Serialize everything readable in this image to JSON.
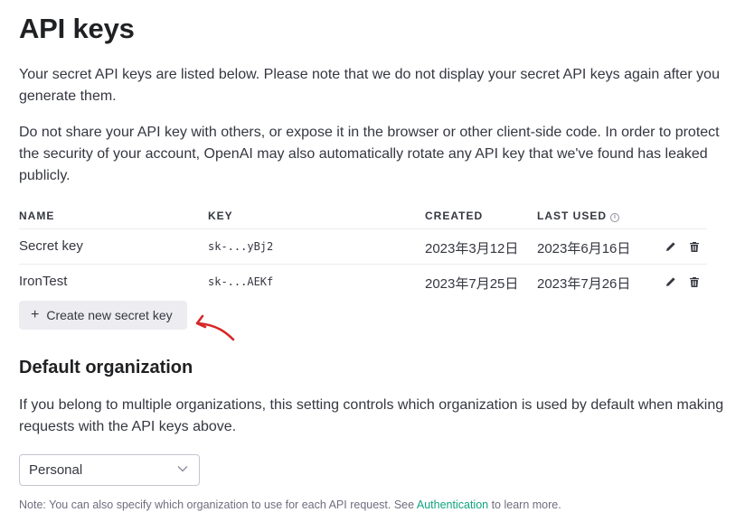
{
  "page": {
    "title": "API keys",
    "intro": "Your secret API keys are listed below. Please note that we do not display your secret API keys again after you generate them.",
    "warning": "Do not share your API key with others, or expose it in the browser or other client-side code. In order to protect the security of your account, OpenAI may also automatically rotate any API key that we've found has leaked publicly."
  },
  "table": {
    "headers": {
      "name": "NAME",
      "key": "KEY",
      "created": "CREATED",
      "last_used": "LAST USED",
      "info_glyph": "i"
    },
    "rows": [
      {
        "name": "Secret key",
        "key": "sk-...yBj2",
        "created": "2023年3月12日",
        "last_used": "2023年6月16日"
      },
      {
        "name": "IronTest",
        "key": "sk-...AEKf",
        "created": "2023年7月25日",
        "last_used": "2023年7月26日"
      }
    ],
    "icons": {
      "edit": "pencil-icon",
      "delete": "trash-icon"
    }
  },
  "create_button": {
    "label": "Create new secret key",
    "icon": "plus-icon"
  },
  "annotation": {
    "icon": "red-curved-arrow",
    "color": "#d62828"
  },
  "default_org": {
    "title": "Default organization",
    "description": "If you belong to multiple organizations, this setting controls which organization is used by default when making requests with the API keys above.",
    "selected": "Personal",
    "icon": "chevron-down-icon"
  },
  "note": {
    "prefix": "Note: You can also specify which organization to use for each API request. See ",
    "link": "Authentication",
    "suffix": " to learn more.",
    "link_color": "#10a37f"
  }
}
